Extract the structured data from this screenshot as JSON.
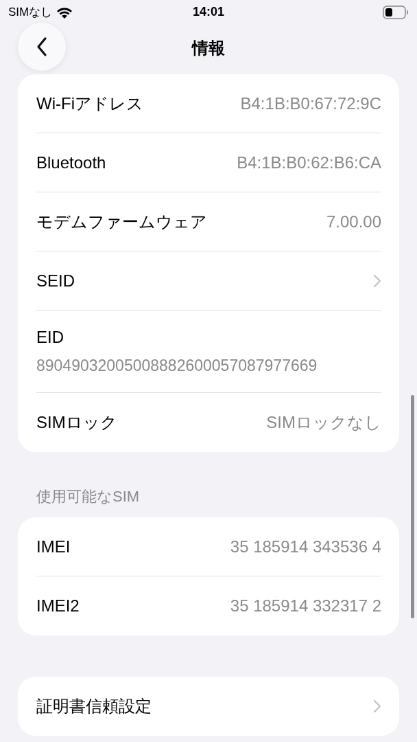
{
  "status_bar": {
    "carrier": "SIMなし",
    "time": "14:01"
  },
  "nav": {
    "title": "情報"
  },
  "sections": [
    {
      "rows": [
        {
          "kind": "value",
          "label": "Wi-Fiアドレス",
          "value": "B4:1B:B0:67:72:9C"
        },
        {
          "kind": "value",
          "label": "Bluetooth",
          "value": "B4:1B:B0:62:B6:CA"
        },
        {
          "kind": "value",
          "label": "モデムファームウェア",
          "value": "7.00.00"
        },
        {
          "kind": "link",
          "label": "SEID"
        },
        {
          "kind": "stacked",
          "label": "EID",
          "value": "89049032005008882600057087977669"
        },
        {
          "kind": "value",
          "label": "SIMロック",
          "value": "SIMロックなし"
        }
      ]
    },
    {
      "header": "使用可能なSIM",
      "rows": [
        {
          "kind": "value",
          "label": "IMEI",
          "value": "35 185914 343536 4"
        },
        {
          "kind": "value",
          "label": "IMEI2",
          "value": "35 185914 332317 2"
        }
      ]
    },
    {
      "rows": [
        {
          "kind": "link",
          "label": "証明書信頼設定"
        }
      ]
    }
  ]
}
